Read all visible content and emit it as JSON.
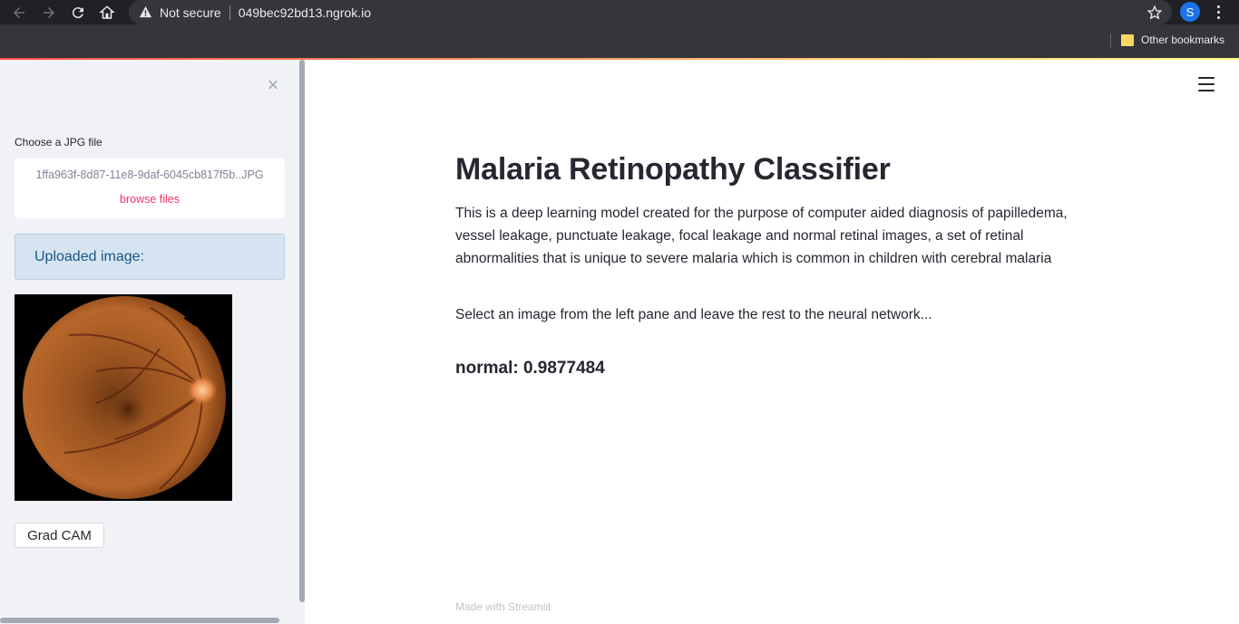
{
  "browser": {
    "security_label": "Not secure",
    "url": "049bec92bd13.ngrok.io",
    "profile_initial": "S",
    "bookmarks_label": "Other bookmarks"
  },
  "sidebar": {
    "close_icon": "×",
    "uploader_label": "Choose a JPG file",
    "file_name": "1ffa963f-8d87-11e8-9daf-6045cb817f5b..JPG",
    "browse_label": "browse files",
    "info_text": "Uploaded image:",
    "gradcam_label": "Grad CAM"
  },
  "main": {
    "title": "Malaria Retinopathy Classifier",
    "description": "This is a deep learning model created for the purpose of computer aided diagnosis of papilledema, vessel leakage, punctuate leakage, focal leakage and normal retinal images, a set of retinal abnormalities that is unique to severe malaria which is common in children with cerebral malaria",
    "instruction": "Select an image from the left pane and leave the rest to the neural network...",
    "result": "normal: 0.9877484",
    "footer": "Made with Streamlit"
  },
  "colors": {
    "accent": "#f63366",
    "info_bg": "#d6e4f2",
    "info_text": "#1b5585",
    "sidebar_bg": "#f0f2f6"
  }
}
